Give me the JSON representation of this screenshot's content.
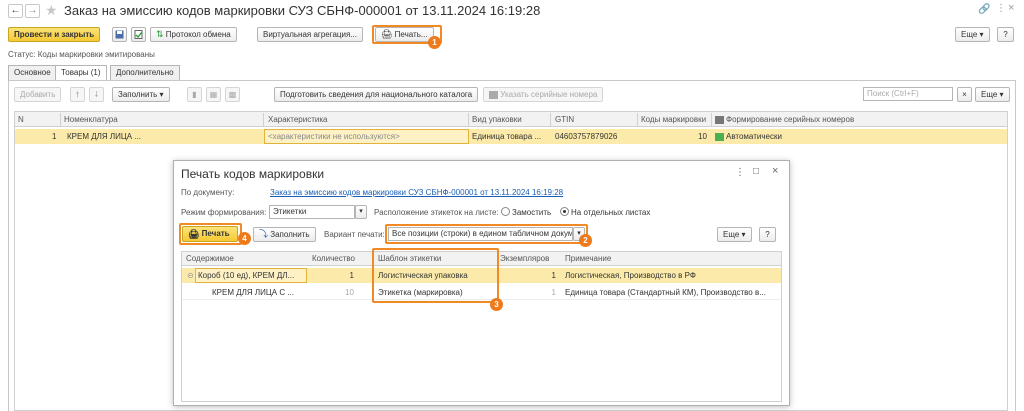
{
  "window": {
    "title": "Заказ на эмиссию кодов маркировки СУЗ СБНФ-000001 от 13.11.2024 16:19:28",
    "more_label": "Еще",
    "help_label": "?"
  },
  "toolbar": {
    "post_close_label": "Провести и закрыть",
    "exchange_label": "Протокол обмена",
    "virtual_agg_label": "Виртуальная агрегация...",
    "print_label": "Печать...",
    "more_label": "Еще",
    "help_label": "?"
  },
  "status_text": "Статус: Коды маркировки эмитированы",
  "tabs": [
    {
      "label": "Основное"
    },
    {
      "label": "Товары (1)"
    },
    {
      "label": "Дополнительно"
    }
  ],
  "goods_toolbar": {
    "add_label": "Добавить",
    "fill_label": "Заполнить",
    "prepare_label": "Подготовить сведения для национального каталога",
    "serials_label": "Указать серийные номера",
    "search_placeholder": "Поиск (Ctrl+F)",
    "clear_label": "×",
    "more_label": "Еще"
  },
  "goods_table": {
    "headers": {
      "n": "N",
      "nomenclature": "Номенклатура",
      "characteristic": "Характеристика",
      "pack_type": "Вид упаковки",
      "gtin": "GTIN",
      "codes": "Коды маркировки",
      "serial_gen": "Формирование серийных номеров"
    },
    "row": {
      "n": "1",
      "nomenclature": "КРЕМ ДЛЯ ЛИЦА ...",
      "characteristic": "<характеристики не используются>",
      "pack_type": "Единица товара ...",
      "gtin": "04603757879026",
      "codes": "10",
      "serial_gen": "Автоматически"
    }
  },
  "dialog": {
    "title": "Печать кодов маркировки",
    "doc_label": "По документу:",
    "doc_link": "Заказ на эмиссию кодов маркировки СУЗ СБНФ-000001 от 13.11.2024 16:19:28",
    "mode_label": "Режим формирования:",
    "mode_value": "Этикетки",
    "layout_label": "Расположение этикеток на листе:",
    "opt_tile": "Замостить",
    "opt_separate": "На отдельных листах",
    "print_label": "Печать",
    "fill_label": "Заполнить",
    "variant_label": "Вариант печати:",
    "variant_value": "Все позиции (строки) в едином табличном докум",
    "more_label": "Еще",
    "help_label": "?",
    "headers": {
      "content": "Содержимое",
      "qty": "Количество",
      "template": "Шаблон этикетки",
      "copies": "Экземпляров",
      "note": "Примечание"
    },
    "rows": [
      {
        "content": "Короб (10 ед), КРЕМ ДЛ...",
        "qty": "1",
        "template": "Логистическая упаковка",
        "copies": "1",
        "note": "Логистическая, Производство в РФ"
      },
      {
        "content": "КРЕМ ДЛЯ ЛИЦА С ...",
        "qty": "10",
        "template": "Этикетка (маркировка)",
        "copies": "1",
        "note": "Единица товара (Стандартный КМ), Производство в..."
      }
    ]
  },
  "badges": [
    "1",
    "2",
    "3",
    "4"
  ],
  "colors": {
    "accent": "#f08a24",
    "highlight_row": "#fbeaa9",
    "link": "#1a5fb4"
  }
}
